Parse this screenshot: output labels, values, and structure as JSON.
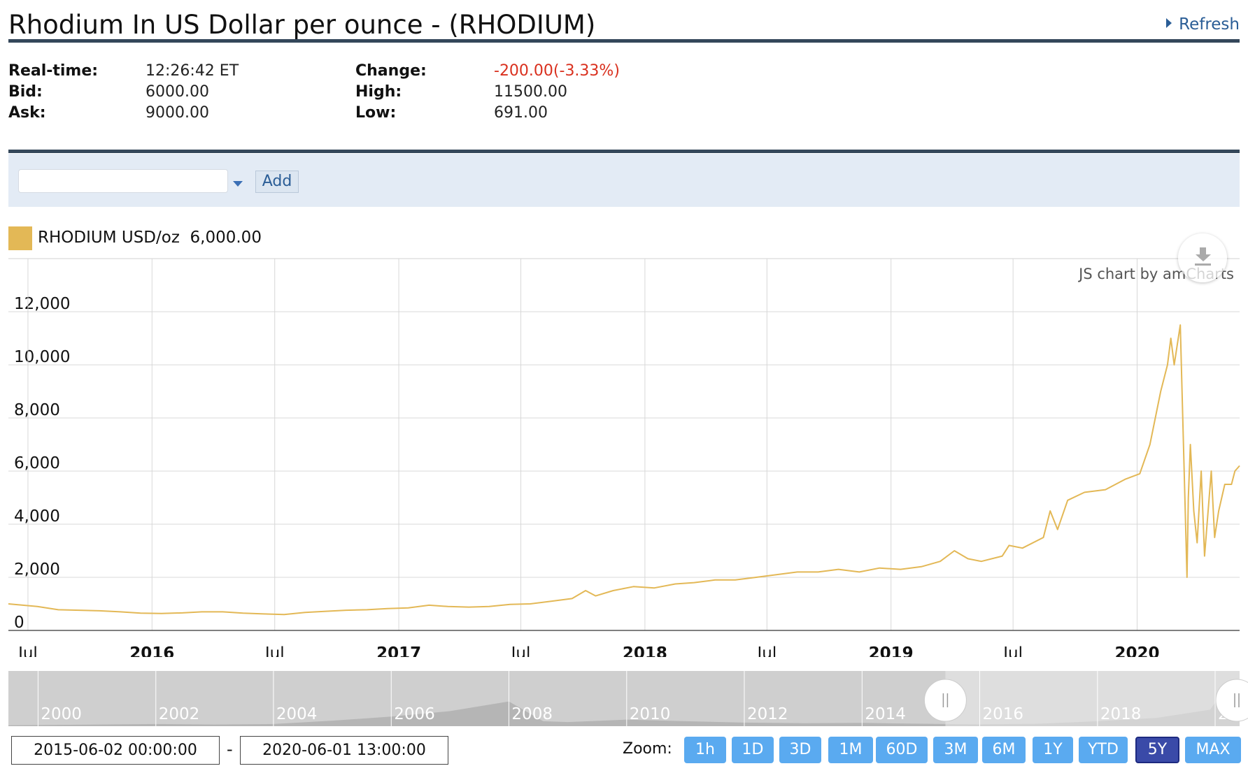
{
  "header": {
    "title": "Rhodium In US Dollar per ounce - (RHODIUM)",
    "refresh_label": "Refresh"
  },
  "stats": {
    "realtime_label": "Real-time:",
    "realtime_value": "12:26:42 ET",
    "bid_label": "Bid:",
    "bid_value": "6000.00",
    "ask_label": "Ask:",
    "ask_value": "9000.00",
    "change_label": "Change:",
    "change_value": "-200.00(-3.33%)",
    "high_label": "High:",
    "high_value": "11500.00",
    "low_label": "Low:",
    "low_value": "691.00"
  },
  "toolbar": {
    "symbol_value": "",
    "add_label": "Add"
  },
  "legend": {
    "label": "RHODIUM USD/oz",
    "value": "6,000.00",
    "color": "#e3b856"
  },
  "credit": "JS chart by amCharts",
  "chart_data": {
    "type": "line",
    "series": [
      {
        "name": "RHODIUM USD/oz",
        "color": "#e3b856",
        "x": [
          "2015-06-02",
          "2015-07-15",
          "2015-08-15",
          "2015-09-15",
          "2015-10-15",
          "2015-11-15",
          "2015-12-15",
          "2016-01-15",
          "2016-02-15",
          "2016-03-15",
          "2016-04-15",
          "2016-05-15",
          "2016-06-15",
          "2016-07-15",
          "2016-08-15",
          "2016-09-15",
          "2016-10-15",
          "2016-11-15",
          "2016-12-15",
          "2017-01-15",
          "2017-02-15",
          "2017-03-15",
          "2017-04-15",
          "2017-05-15",
          "2017-06-15",
          "2017-07-15",
          "2017-08-15",
          "2017-09-15",
          "2017-10-05",
          "2017-10-20",
          "2017-11-15",
          "2017-12-15",
          "2018-01-15",
          "2018-02-15",
          "2018-03-15",
          "2018-04-15",
          "2018-05-15",
          "2018-06-15",
          "2018-07-15",
          "2018-08-15",
          "2018-09-15",
          "2018-10-15",
          "2018-11-15",
          "2018-12-15",
          "2019-01-15",
          "2019-02-15",
          "2019-03-15",
          "2019-04-05",
          "2019-04-25",
          "2019-05-15",
          "2019-06-15",
          "2019-06-25",
          "2019-07-15",
          "2019-08-15",
          "2019-08-25",
          "2019-09-05",
          "2019-09-20",
          "2019-10-15",
          "2019-11-15",
          "2019-12-15",
          "2020-01-05",
          "2020-01-20",
          "2020-02-05",
          "2020-02-15",
          "2020-02-20",
          "2020-02-25",
          "2020-03-05",
          "2020-03-15",
          "2020-03-17",
          "2020-03-20",
          "2020-03-25",
          "2020-03-30",
          "2020-04-05",
          "2020-04-10",
          "2020-04-20",
          "2020-04-25",
          "2020-05-01",
          "2020-05-10",
          "2020-05-20",
          "2020-05-25",
          "2020-06-01"
        ],
        "values": [
          1000,
          900,
          780,
          760,
          740,
          700,
          650,
          640,
          660,
          700,
          700,
          650,
          620,
          600,
          680,
          720,
          760,
          780,
          820,
          850,
          950,
          900,
          880,
          900,
          980,
          1000,
          1100,
          1200,
          1500,
          1300,
          1500,
          1650,
          1600,
          1750,
          1800,
          1900,
          1900,
          2000,
          2100,
          2200,
          2200,
          2300,
          2200,
          2350,
          2300,
          2400,
          2600,
          3000,
          2700,
          2600,
          2800,
          3200,
          3100,
          3500,
          4500,
          3800,
          4900,
          5200,
          5300,
          5700,
          5900,
          7000,
          9000,
          10000,
          11000,
          10000,
          11500,
          2000,
          5000,
          7000,
          4500,
          3300,
          6000,
          2800,
          6000,
          3500,
          4500,
          5500,
          5500,
          6000,
          6200
        ]
      }
    ],
    "y_ticks": [
      "0",
      "2,000",
      "4,000",
      "6,000",
      "8,000",
      "10,000",
      "12,000"
    ],
    "x_ticks": [
      "Jul",
      "2016",
      "Jul",
      "2017",
      "Jul",
      "2018",
      "Jul",
      "2019",
      "Jul",
      "2020"
    ],
    "ylim": [
      0,
      14000
    ],
    "xlim": [
      "2015-06-02",
      "2020-06-01"
    ],
    "grid": true,
    "navigator": {
      "labels": [
        "2000",
        "2002",
        "2004",
        "2006",
        "2008",
        "2010",
        "2012",
        "2014",
        "2016",
        "2018",
        "20"
      ]
    }
  },
  "period": {
    "start": "2015-06-02 00:00:00",
    "end": "2020-06-01 13:00:00",
    "separator": "-"
  },
  "zoom": {
    "label": "Zoom:",
    "buttons": [
      "1h",
      "1D",
      "3D",
      "1M",
      "60D",
      "3M",
      "6M",
      "1Y",
      "YTD",
      "5Y",
      "MAX"
    ],
    "active": "5Y"
  }
}
